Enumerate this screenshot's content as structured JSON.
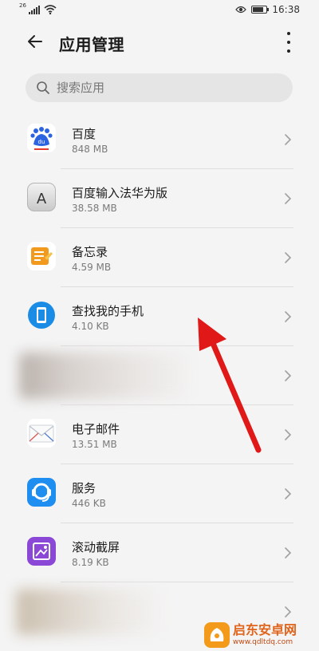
{
  "status_bar": {
    "network": "26",
    "time": "16:38"
  },
  "header": {
    "title": "应用管理"
  },
  "search": {
    "placeholder": "搜索应用"
  },
  "apps": [
    {
      "name": "百度",
      "size": "848 MB",
      "icon": "baidu-icon"
    },
    {
      "name": "百度输入法华为版",
      "size": "38.58 MB",
      "icon": "baidu-input-icon"
    },
    {
      "name": "备忘录",
      "size": "4.59 MB",
      "icon": "notepad-icon"
    },
    {
      "name": "查找我的手机",
      "size": "4.10 KB",
      "icon": "find-phone-icon"
    },
    {
      "name": "",
      "size": "",
      "icon": "blurred-icon"
    },
    {
      "name": "电子邮件",
      "size": "13.51 MB",
      "icon": "email-icon"
    },
    {
      "name": "服务",
      "size": "446 KB",
      "icon": "service-icon"
    },
    {
      "name": "滚动截屏",
      "size": "8.19 KB",
      "icon": "scroll-screenshot-icon"
    },
    {
      "name": "",
      "size": "",
      "icon": "blurred-icon"
    }
  ],
  "watermark": {
    "title": "启东安卓网",
    "url": "www.qdltdq.com"
  },
  "colors": {
    "arrow": "#e01818",
    "background": "#f4f4f4",
    "search_bg": "#e5e5e5"
  }
}
